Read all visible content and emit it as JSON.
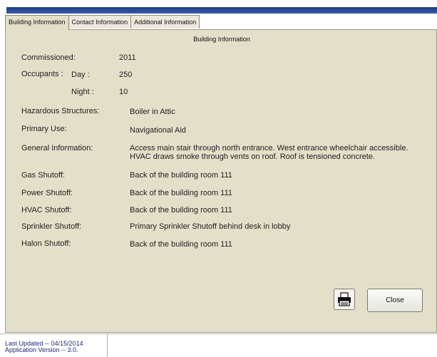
{
  "tabs": [
    {
      "label": "Building Information"
    },
    {
      "label": "Contact Information"
    },
    {
      "label": "Additional Information"
    }
  ],
  "panel_title": "Building Information",
  "fields": {
    "commissioned": {
      "label": "Commissioned:",
      "value": "2011"
    },
    "occupants": {
      "label": "Occupants :",
      "day_label": "Day :",
      "day_value": "250",
      "night_label": "Night :",
      "night_value": "10"
    },
    "hazardous": {
      "label": "Hazardous Structures:",
      "value": "Boiler in Attic"
    },
    "primary_use": {
      "label": "Primary Use:",
      "value": "Navigational Aid"
    },
    "general": {
      "label": "General Information:",
      "value": "Access main stair through north entrance. West entrance wheelchair accessible. HVAC draws smoke through vents on roof. Roof is tensioned concrete."
    },
    "gas": {
      "label": "Gas Shutoff:",
      "value": "Back of the building room 111"
    },
    "power": {
      "label": "Power Shutoff:",
      "value": "Back of the building room 111"
    },
    "hvac": {
      "label": "HVAC Shutoff:",
      "value": "Back of the building room 111"
    },
    "sprinkler": {
      "label": "Sprinkler Shutoff:",
      "value": "Primary Sprinkler Shutoff behind desk in lobby"
    },
    "halon": {
      "label": "Halon Shutoff:",
      "value": "Back of the building room 111"
    }
  },
  "buttons": {
    "print_icon": "printer-icon",
    "close_label": "Close"
  },
  "status": {
    "last_updated": "Last Updated -- 04/15/2014",
    "app_version": "Application Version -- 3.0."
  },
  "colors": {
    "title_bar": "#1d3b86",
    "panel_bg": "#e4dfc8"
  }
}
